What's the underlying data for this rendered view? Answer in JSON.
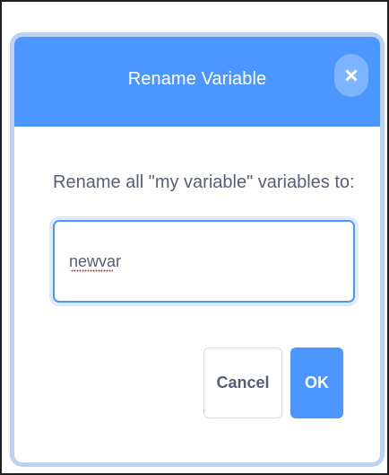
{
  "dialog": {
    "title": "Rename Variable",
    "close_icon": "close-icon",
    "prompt": "Rename all \"my variable\" variables to:",
    "input_value": "newvar",
    "cancel_label": "Cancel",
    "ok_label": "OK"
  },
  "colors": {
    "header": "#4c97ff",
    "ok_button": "#4c97ff",
    "text": "#575e75",
    "input_border": "#4c97ff",
    "spellcheck_underline": "#e03030"
  }
}
